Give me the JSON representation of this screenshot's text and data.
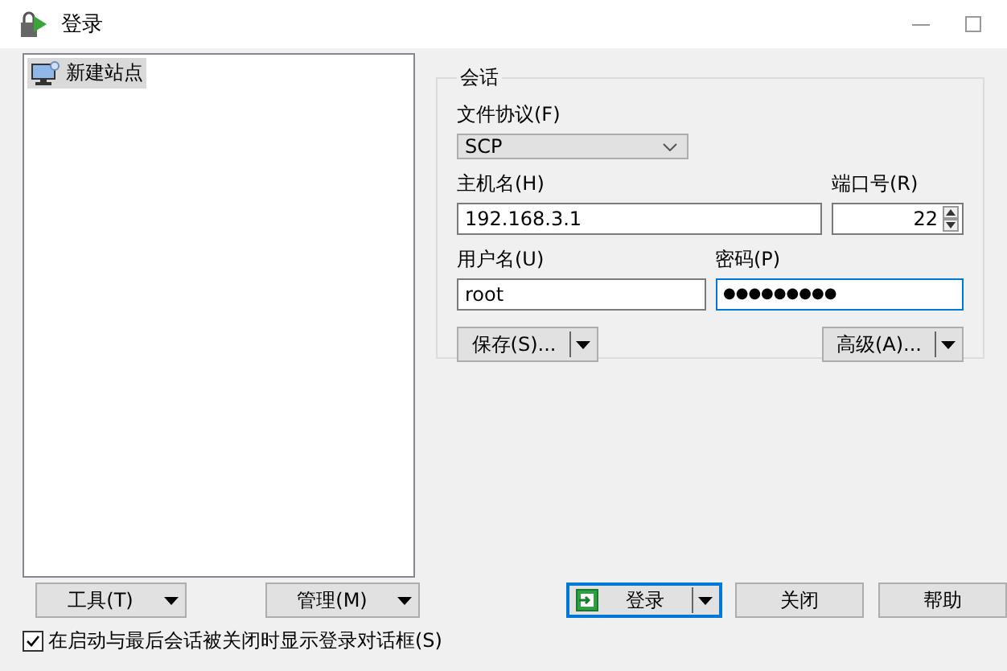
{
  "window": {
    "title": "登录"
  },
  "site_tree": {
    "items": [
      {
        "label": "新建站点",
        "selected": true
      }
    ]
  },
  "session": {
    "title": "会话",
    "protocol": {
      "label": "文件协议(F)",
      "value": "SCP"
    },
    "host": {
      "label": "主机名(H)",
      "value": "192.168.3.1"
    },
    "port": {
      "label": "端口号(R)",
      "value": "22"
    },
    "user": {
      "label": "用户名(U)",
      "value": "root"
    },
    "password": {
      "label": "密码(P)",
      "value": "●●●●●●●●●",
      "focused": true
    },
    "buttons": [
      {
        "label": "保存(S)...",
        "kind": "split"
      },
      {
        "label": "高级(A)...",
        "kind": "split"
      }
    ]
  },
  "bottom_buttons": [
    {
      "label": "工具(T)",
      "kind": "menu",
      "default": false
    },
    {
      "label": "管理(M)",
      "kind": "menu",
      "default": false
    },
    {
      "label": "登录",
      "kind": "login",
      "default": true
    },
    {
      "label": "关闭",
      "kind": "plain",
      "default": false
    },
    {
      "label": "帮助",
      "kind": "plain",
      "default": false
    }
  ],
  "show_on_start": {
    "label": "在启动与最后会话被关闭时显示登录对话框(S)",
    "checked": true
  }
}
